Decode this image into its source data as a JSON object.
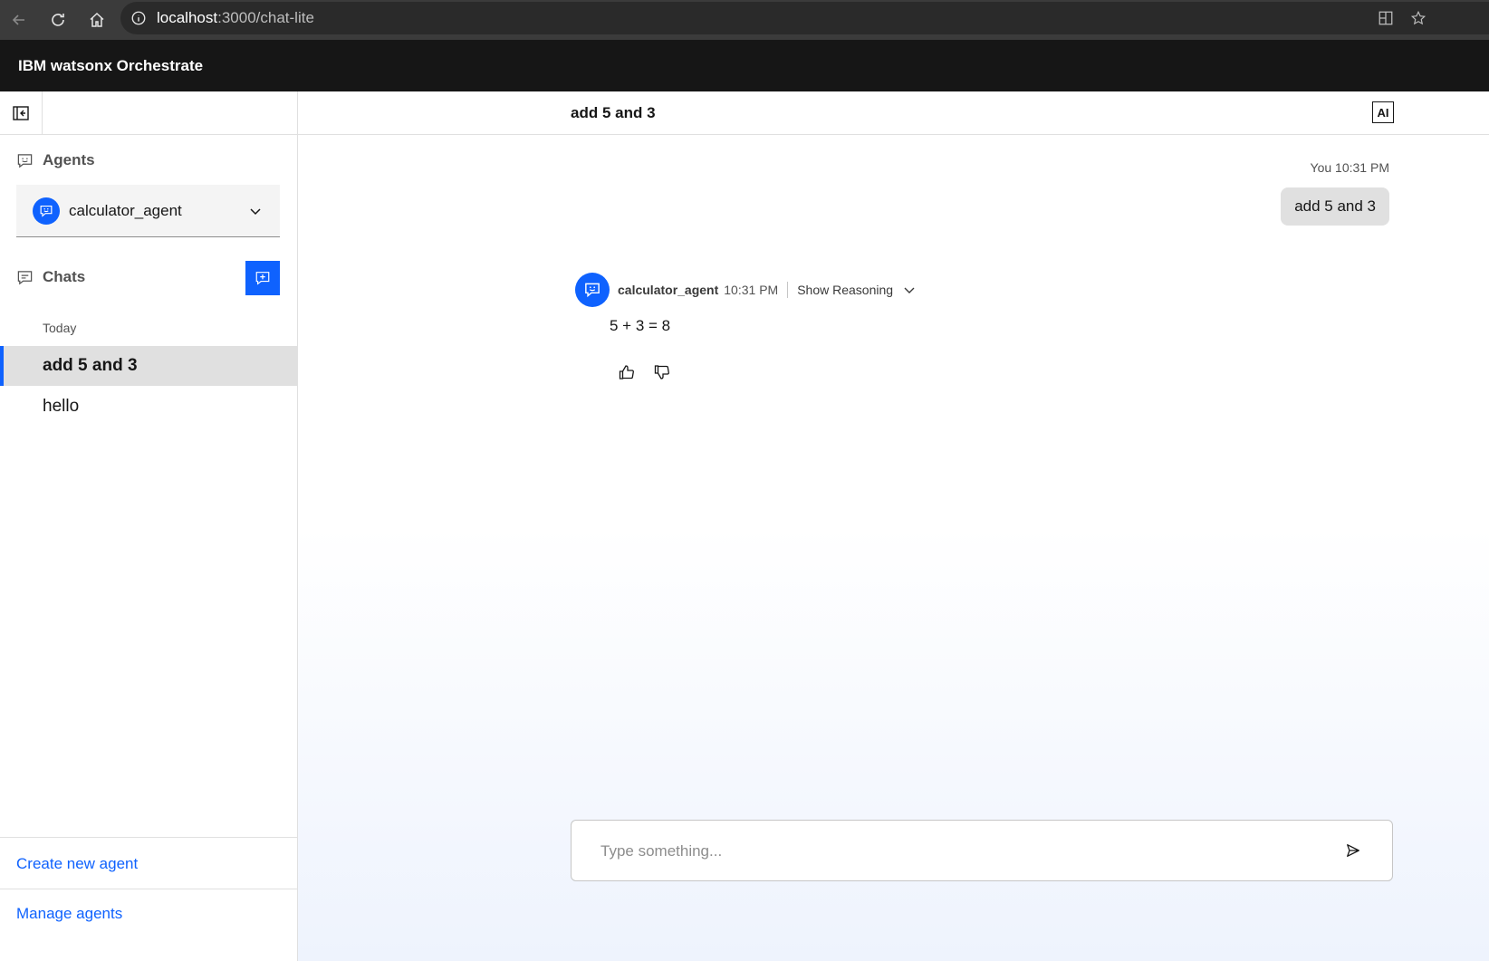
{
  "browser": {
    "url_host": "localhost",
    "url_path": ":3000/chat-lite"
  },
  "app": {
    "title": "IBM watsonx Orchestrate"
  },
  "sidebar": {
    "agents_label": "Agents",
    "selected_agent": "calculator_agent",
    "chats_label": "Chats",
    "today_label": "Today",
    "chats": [
      {
        "label": "add 5 and 3",
        "active": true
      },
      {
        "label": "hello",
        "active": false
      }
    ],
    "create_agent_link": "Create new agent",
    "manage_agents_link": "Manage agents"
  },
  "main": {
    "chat_title": "add 5 and 3",
    "ai_badge": "AI",
    "user_message": {
      "meta": "You 10:31 PM",
      "text": "add 5 and 3"
    },
    "bot_message": {
      "name": "calculator_agent",
      "time": "10:31 PM",
      "reasoning_label": "Show Reasoning",
      "text": "5 + 3 = 8"
    },
    "composer": {
      "placeholder": "Type something..."
    }
  },
  "colors": {
    "accent": "#0f62fe",
    "header_bg": "#161616",
    "browser_bg": "#3b3b3b"
  }
}
